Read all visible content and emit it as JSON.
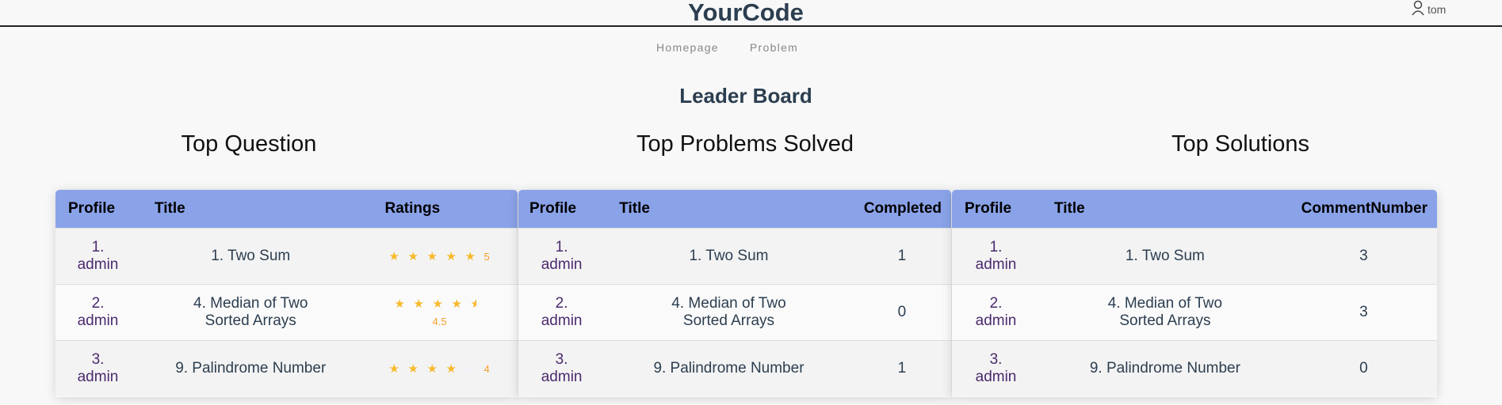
{
  "header": {
    "brand": "YourCode",
    "user": "tom"
  },
  "nav": [
    "Homepage",
    "Problem"
  ],
  "page_title": "Leader Board",
  "sections": [
    {
      "heading": "Top Question",
      "columns": [
        "Profile",
        "Title",
        "Ratings"
      ],
      "rows": [
        {
          "rank": "1.",
          "user": "admin",
          "title": "1. Two Sum",
          "rating": 5,
          "rating_label": "5"
        },
        {
          "rank": "2.",
          "user": "admin",
          "title": "4. Median of Two Sorted Arrays",
          "rating": 4.5,
          "rating_label": "4.5"
        },
        {
          "rank": "3.",
          "user": "admin",
          "title": "9. Palindrome Number",
          "rating": 4,
          "rating_label": "4"
        }
      ]
    },
    {
      "heading": "Top Problems Solved",
      "columns": [
        "Profile",
        "Title",
        "Completed"
      ],
      "rows": [
        {
          "rank": "1.",
          "user": "admin",
          "title": "1. Two Sum",
          "value": "1"
        },
        {
          "rank": "2.",
          "user": "admin",
          "title": "4. Median of Two Sorted Arrays",
          "value": "0"
        },
        {
          "rank": "3.",
          "user": "admin",
          "title": "9. Palindrome Number",
          "value": "1"
        }
      ]
    },
    {
      "heading": "Top Solutions",
      "columns": [
        "Profile",
        "Title",
        "CommentNumber"
      ],
      "rows": [
        {
          "rank": "1.",
          "user": "admin",
          "title": "1. Two Sum",
          "value": "3"
        },
        {
          "rank": "2.",
          "user": "admin",
          "title": "4. Median of Two Sorted Arrays",
          "value": "3"
        },
        {
          "rank": "3.",
          "user": "admin",
          "title": "9. Palindrome Number",
          "value": "0"
        }
      ]
    }
  ],
  "colors": {
    "header_bg": "#8aa2e8",
    "star": "#f7ba2a",
    "profile_link": "#4b2a6e"
  }
}
